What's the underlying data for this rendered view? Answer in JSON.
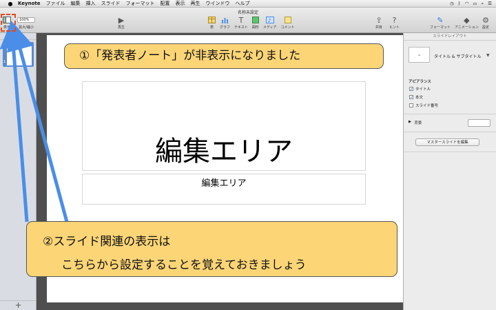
{
  "menubar": {
    "app_name": "Keynote",
    "items": [
      "ファイル",
      "編集",
      "挿入",
      "スライド",
      "フォーマット",
      "配置",
      "表示",
      "再生",
      "ウインドウ",
      "ヘルプ"
    ]
  },
  "toolbar": {
    "doc_title": "名称未設定",
    "view_label": "表示",
    "zoom_value": "100%",
    "zoom_label": "拡大/縮小",
    "play_label": "再生",
    "insert": {
      "table": "表",
      "chart": "グラフ",
      "text": "テキスト",
      "shape": "図形",
      "media": "メディア",
      "comment": "コメント"
    },
    "share_label": "共有",
    "tips_label": "ヒント",
    "format_label": "フォーマット",
    "animate_label": "アニメーション",
    "setup_label": "設定"
  },
  "navigator": {
    "slide_number": "1",
    "add_label": "+"
  },
  "slide": {
    "title": "編集エリア",
    "body": "編集エリア"
  },
  "inspector": {
    "header": "スライドレイアウト",
    "layout_name": "タイトル & サブタイトル",
    "appearance_heading": "アピアランス",
    "checkboxes": [
      {
        "label": "タイトル",
        "checked": true
      },
      {
        "label": "本文",
        "checked": true
      },
      {
        "label": "スライド番号",
        "checked": false
      }
    ],
    "background_label": "背景",
    "edit_master_button": "マスタースライドを編集"
  },
  "annotations": {
    "callout1": "①「発表者ノート」が非表示になりました",
    "callout2_line1": "②スライド関連の表示は",
    "callout2_line2": "こちらから設定することを覚えておきましょう",
    "accent_color": "#fcd577",
    "arrow_color": "#4a8ee8",
    "highlight_color": "#e54a20"
  }
}
